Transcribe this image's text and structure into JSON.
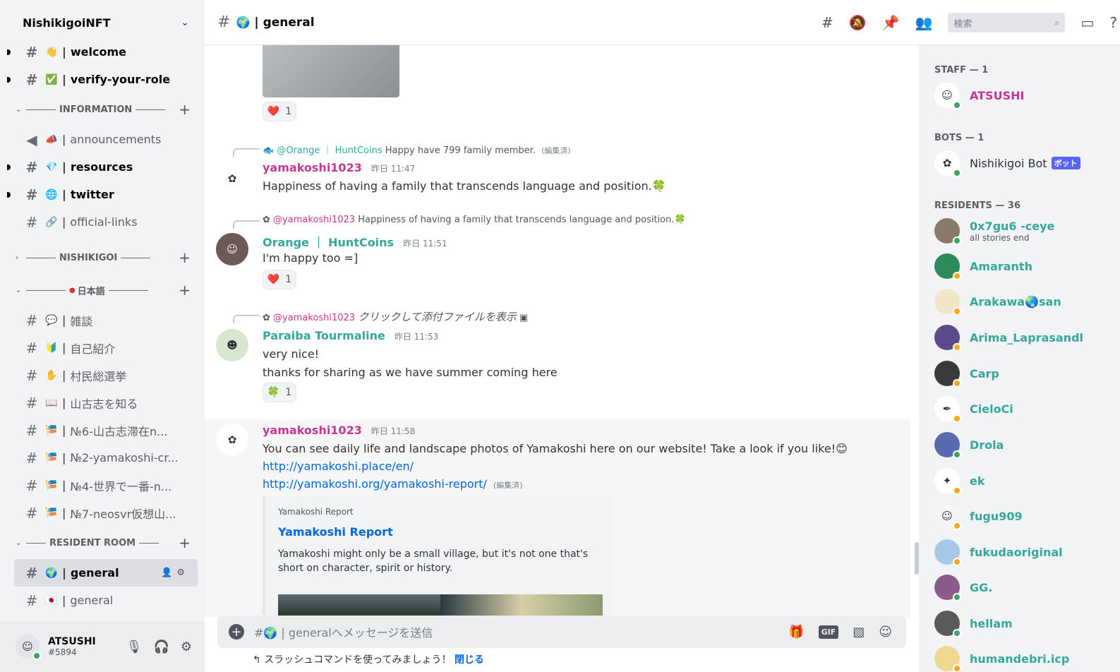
{
  "server": {
    "name": "NishikigoiNFT"
  },
  "channels": {
    "welcome": {
      "emoji": "👋",
      "name": "welcome"
    },
    "verify": {
      "emoji": "✅",
      "name": "verify-your-role"
    },
    "cat_information": "INFORMATION",
    "announcements": {
      "emoji": "📣",
      "name": "announcements"
    },
    "resources": {
      "emoji": "💎",
      "name": "resources"
    },
    "twitter": {
      "emoji": "🌐",
      "name": "twitter"
    },
    "official_links": {
      "emoji": "🔗",
      "name": "official-links"
    },
    "cat_nishikigoi": "NISHIKIGOI",
    "cat_japanese": "日本語",
    "zatsudan": {
      "emoji": "💬",
      "name": "雑談"
    },
    "jiko": {
      "emoji": "🔰",
      "name": "自己紹介"
    },
    "sonmin": {
      "emoji": "✋",
      "name": "村民総選挙"
    },
    "yamakoshi": {
      "emoji": "📖",
      "name": "山古志を知る"
    },
    "no6": {
      "emoji": "🎏",
      "name": "№6-山古志滞在n..."
    },
    "no2": {
      "emoji": "🎏",
      "name": "№2-yamakoshi-cr..."
    },
    "no4": {
      "emoji": "🎏",
      "name": "№4-世界で一番-n..."
    },
    "no7": {
      "emoji": "🎏",
      "name": "№7-neosvr仮想山..."
    },
    "cat_resident": "RESIDENT ROOM",
    "general_active": {
      "emoji": "🌍",
      "name": "general"
    },
    "general_jp": {
      "emoji": "🇯🇵",
      "name": "general"
    }
  },
  "user": {
    "name": "ATSUSHI",
    "tag": "#5894"
  },
  "topbar": {
    "emoji": "🌍",
    "title": "general",
    "search_placeholder": "検索"
  },
  "messages": {
    "top_reaction": {
      "emoji": "❤️",
      "count": "1"
    },
    "m1": {
      "reply_author": "@Orange ｜ HuntCoins",
      "reply_text": "Happy have 799 family member.",
      "reply_edited": "(編集済)",
      "author": "yamakoshi1023",
      "time": "昨日 11:47",
      "text": "Happiness of having a family that transcends language and position.🍀"
    },
    "m2": {
      "reply_author": "@yamakoshi1023",
      "reply_text": "Happiness of having a family that transcends language and position.🍀",
      "author": "Orange ｜ HuntCoins",
      "time": "昨日 11:51",
      "text": "I'm happy too =]",
      "reaction": {
        "emoji": "❤️",
        "count": "1"
      }
    },
    "m3": {
      "reply_author": "@yamakoshi1023",
      "reply_text": "クリックして添付ファイルを表示",
      "author": "Paraiba Tourmaline",
      "time": "昨日 11:53",
      "line1": "very nice!",
      "line2": "thanks for sharing as we have summer coming here",
      "reaction": {
        "emoji": "🍀",
        "count": "1"
      }
    },
    "m4": {
      "author": "yamakoshi1023",
      "time": "昨日 11:58",
      "text": "You can see daily life and landscape photos of Yamakoshi here on our website! Take a look if you like!😊",
      "link1": "http://yamakoshi.place/en/",
      "link2": "http://yamakoshi.org/yamakoshi-report/",
      "edited": "(編集済)",
      "embed": {
        "provider": "Yamakoshi Report",
        "title": "Yamakoshi Report",
        "description": "Yamakoshi might only be a small village, but it's not one that's short on character, spirit or history."
      }
    }
  },
  "composer": {
    "placeholder": "#🌍 | generalへメッセージを送信",
    "gif": "GIF"
  },
  "hint": {
    "text": "スラッシュコマンドを使ってみましょう！",
    "close": "閉じる"
  },
  "members": {
    "staff_header": "STAFF — 1",
    "bots_header": "BOTS — 1",
    "residents_header": "RESIDENTS — 36",
    "staff": [
      {
        "name": "ATSUSHI"
      }
    ],
    "bots": [
      {
        "name": "Nishikigoi Bot",
        "badge": "ボット"
      }
    ],
    "residents": [
      {
        "name": "0x7gu6 -ceye",
        "sub": "all stories end"
      },
      {
        "name": "Amaranth"
      },
      {
        "name": "Arakawa🌏san"
      },
      {
        "name": "Arima_Laprasandl"
      },
      {
        "name": "Carp"
      },
      {
        "name": "CieloCi"
      },
      {
        "name": "Drola"
      },
      {
        "name": "ek"
      },
      {
        "name": "fugu909"
      },
      {
        "name": "fukudaoriginal"
      },
      {
        "name": "GG."
      },
      {
        "name": "hellam"
      },
      {
        "name": "humandebri.icp"
      }
    ]
  },
  "colors": {
    "teal": "#35a89a",
    "pink": "#c6378f",
    "link": "#0067e0",
    "bot_badge": "#5865f2"
  }
}
